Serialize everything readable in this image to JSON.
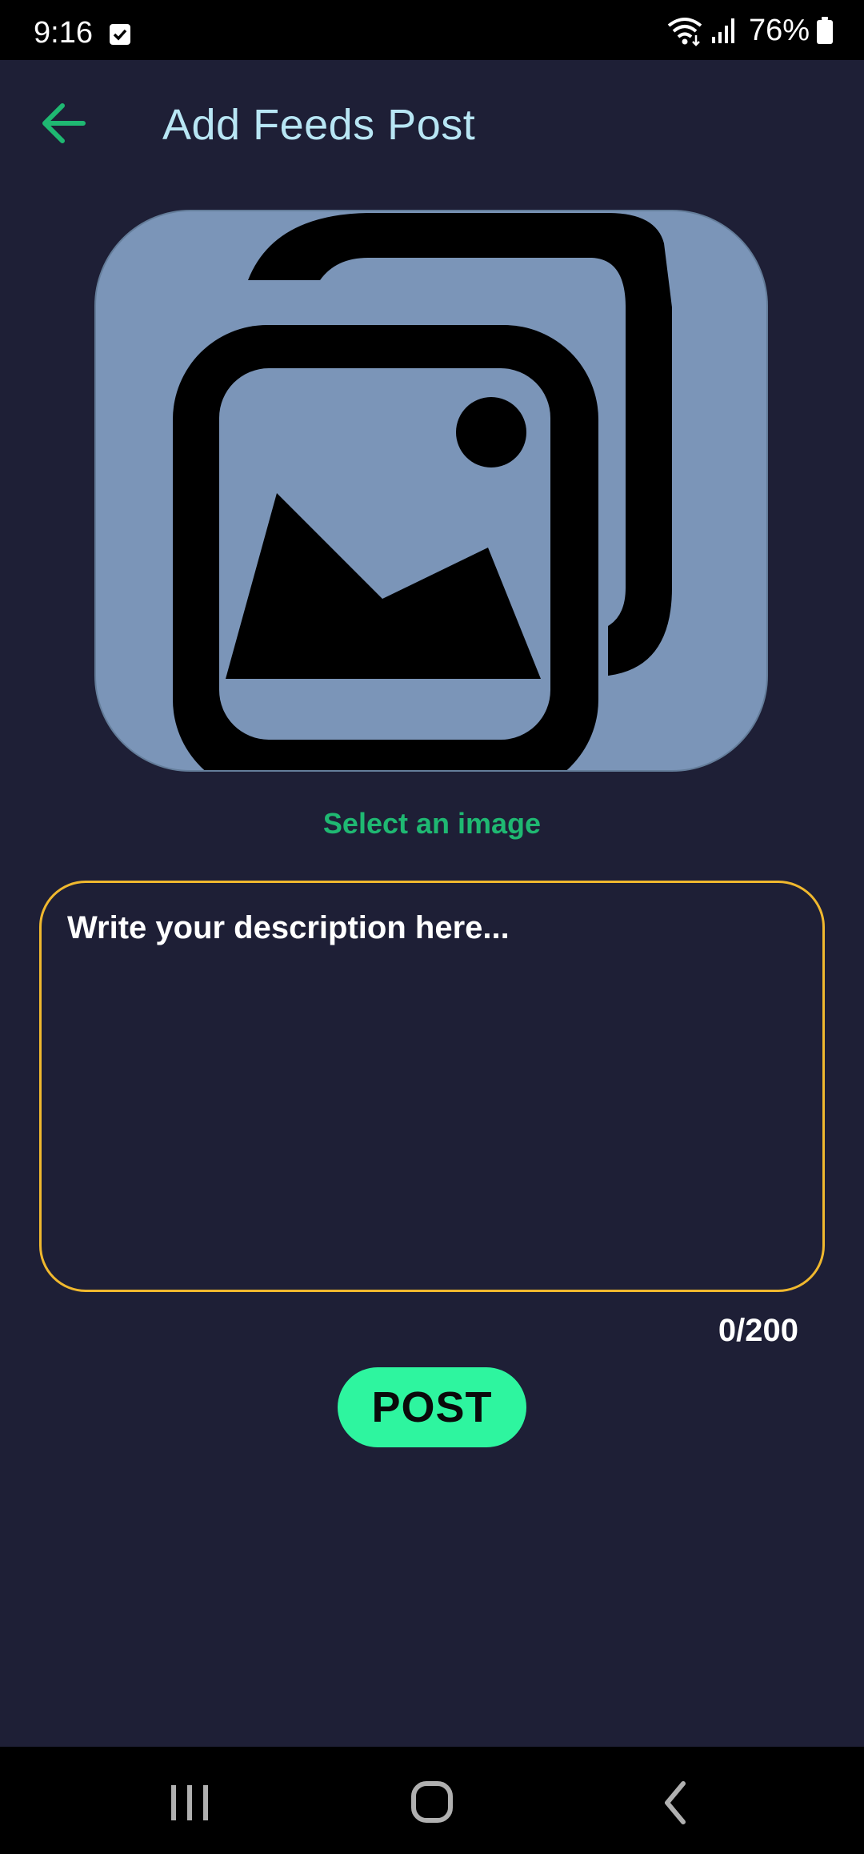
{
  "status_bar": {
    "time": "9:16",
    "battery": "76%",
    "icons": [
      "task-check-icon",
      "wifi-icon",
      "signal-icon",
      "battery-icon"
    ]
  },
  "app_bar": {
    "title": "Add Feeds Post",
    "back_icon": "arrow-left-icon"
  },
  "image_picker": {
    "icon": "image-gallery-icon",
    "label": "Select an image"
  },
  "description": {
    "placeholder": "Write your description here...",
    "value": "",
    "counter": "0/200"
  },
  "post_button": {
    "label": "POST"
  },
  "nav_bar": {
    "icons": [
      "recents-icon",
      "home-icon",
      "back-icon"
    ]
  },
  "colors": {
    "background": "#1e1f36",
    "title": "#b8e6f4",
    "accent_green": "#1fb872",
    "post_button": "#2ef59f",
    "input_border": "#f0b82e",
    "image_bg": "#7b95b8"
  }
}
